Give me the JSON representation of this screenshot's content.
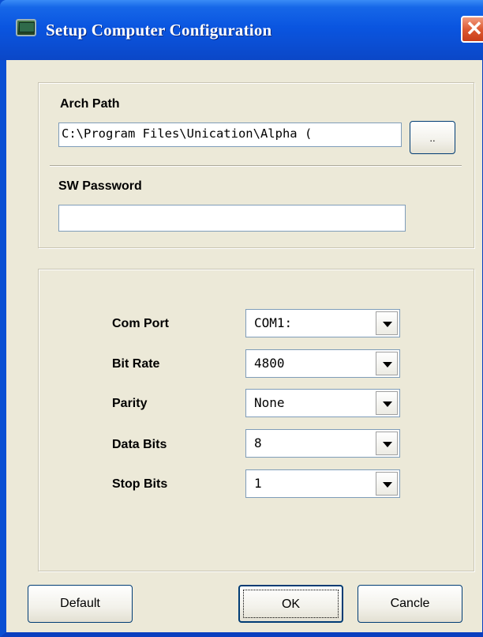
{
  "window": {
    "title": "Setup Computer Configuration",
    "close_glyph": "✕"
  },
  "arch_path": {
    "label": "Arch Path",
    "value": "C:\\Program Files\\Unication\\Alpha (",
    "browse_label": ".."
  },
  "sw_password": {
    "label": "SW Password",
    "value": ""
  },
  "serial": {
    "com_port": {
      "label": "Com Port",
      "value": "COM1:"
    },
    "bit_rate": {
      "label": "Bit Rate",
      "value": "4800"
    },
    "parity": {
      "label": "Parity",
      "value": "None"
    },
    "data_bits": {
      "label": "Data Bits",
      "value": "8"
    },
    "stop_bits": {
      "label": "Stop Bits",
      "value": "1"
    }
  },
  "buttons": {
    "default": "Default",
    "ok": "OK",
    "cancel": "Cancle"
  },
  "colors": {
    "titlebar": "#0a55e0",
    "background": "#ece9d8",
    "close": "#dd5a32"
  },
  "icons": {
    "app": "computer-icon",
    "close": "close-icon",
    "dropdown": "chevron-down-icon"
  }
}
